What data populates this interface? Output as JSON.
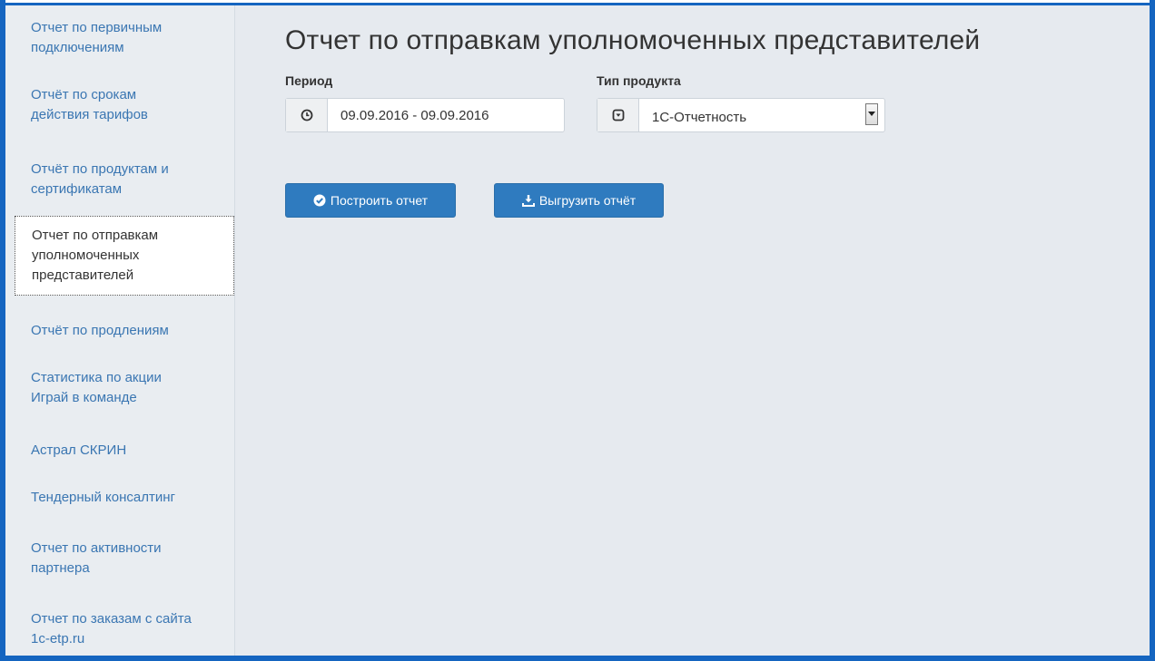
{
  "sidebar": {
    "items": [
      {
        "label_l1": "Отчет по первичным",
        "label_l2": "подключениям"
      },
      {
        "label_l1": "Отчёт по срокам",
        "label_l2": "действия тарифов"
      },
      {
        "label_l1": "Отчёт по продуктам и",
        "label_l2": "сертификатам"
      },
      {
        "label_l1": "Отчет по отправкам",
        "label_l2": "уполномоченных",
        "label_l3": "представителей"
      },
      {
        "label_l1": "Отчёт по продлениям"
      },
      {
        "label_l1": "Статистика по акции",
        "label_l2": "Играй в команде"
      },
      {
        "label_l1": "Астрал СКРИН"
      },
      {
        "label_l1": "Тендерный консалтинг"
      },
      {
        "label_l1": "Отчет по активности",
        "label_l2": "партнера"
      },
      {
        "label_l1": "Отчет по заказам с сайта",
        "label_l2": "1c-etp.ru"
      }
    ],
    "active_index": 3
  },
  "main": {
    "title": "Отчет по отправкам уполномоченных представителей",
    "period": {
      "label": "Период",
      "value": "09.09.2016 - 09.09.2016",
      "icon": "clock-icon"
    },
    "product_type": {
      "label": "Тип продукта",
      "value": "1С-Отчетность",
      "icon": "dropdown-icon"
    },
    "buttons": {
      "build_label": "Построить отчет",
      "export_label": "Выгрузить отчёт"
    }
  },
  "colors": {
    "frame": "#1565c0",
    "link": "#3a76b2",
    "button": "#2f7bbf",
    "background": "#e6eaef"
  }
}
